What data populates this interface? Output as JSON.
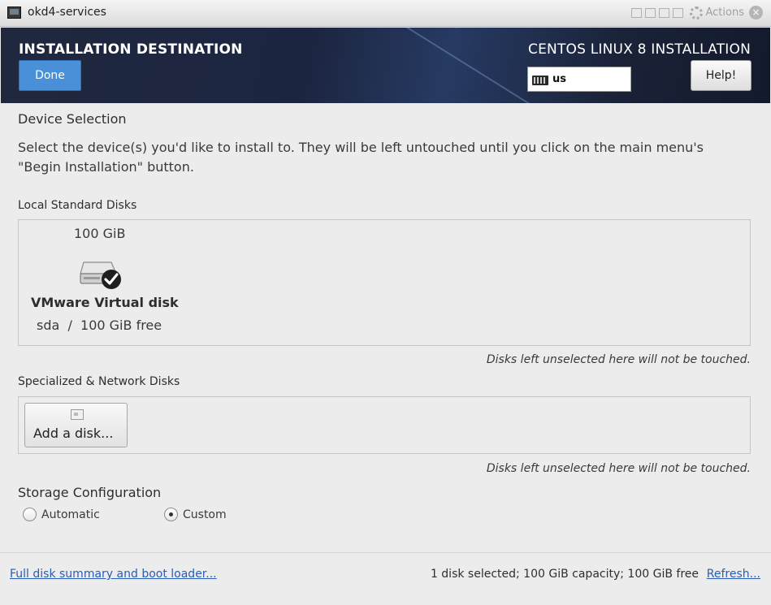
{
  "window": {
    "title": "okd4-services",
    "actions_label": "Actions"
  },
  "header": {
    "title": "INSTALLATION DESTINATION",
    "done_label": "Done",
    "product": "CENTOS LINUX 8 INSTALLATION",
    "keyboard_layout": "us",
    "help_label": "Help!"
  },
  "device_selection": {
    "title": "Device Selection",
    "description": "Select the device(s) you'd like to install to.  They will be left untouched until you click on the main menu's \"Begin Installation\" button."
  },
  "local_disks": {
    "title": "Local Standard Disks",
    "disks": [
      {
        "size": "100 GiB",
        "name": "VMware Virtual disk",
        "detail": "sda  /  100 GiB free",
        "selected": true
      }
    ],
    "note": "Disks left unselected here will not be touched."
  },
  "network_disks": {
    "title": "Specialized & Network Disks",
    "add_label": "Add a disk...",
    "note": "Disks left unselected here will not be touched."
  },
  "storage": {
    "title": "Storage Configuration",
    "options": [
      {
        "label": "Automatic",
        "selected": false
      },
      {
        "label": "Custom",
        "selected": true
      }
    ]
  },
  "footer": {
    "summary_link": "Full disk summary and boot loader...",
    "status": "1 disk selected; 100 GiB capacity; 100 GiB free",
    "refresh_link": "Refresh..."
  },
  "colors": {
    "accent": "#4a90d9",
    "header_bg": "#1c2540",
    "link": "#2a5db0"
  }
}
